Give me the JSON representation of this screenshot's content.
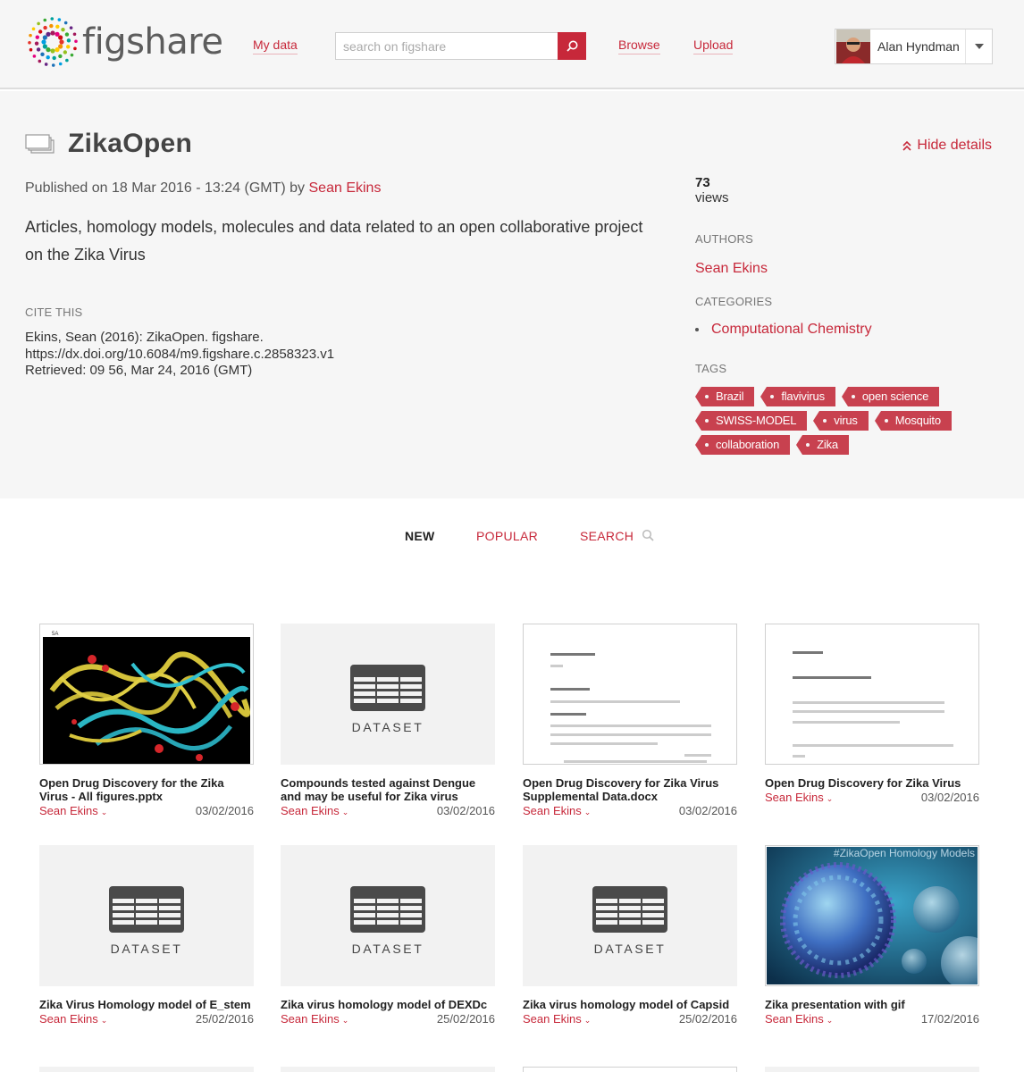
{
  "header": {
    "logo_text": "figshare",
    "nav": {
      "my_data": "My data",
      "browse": "Browse",
      "upload": "Upload"
    },
    "search_placeholder": "search on figshare",
    "user_name": "Alan Hyndman"
  },
  "collection": {
    "title": "ZikaOpen",
    "hide_details": "Hide details",
    "published_prefix": "Published on 18 Mar 2016 - 13:24 (GMT) by",
    "published_author": "Sean Ekins",
    "description": "Articles, homology models, molecules and data related to an open collaborative project on the Zika Virus",
    "cite_label": "CITE THIS",
    "cite_lines": [
      "Ekins, Sean (2016): ZikaOpen. figshare.",
      "https://dx.doi.org/10.6084/m9.figshare.c.2858323.v1",
      "Retrieved: 09 56, Mar 24, 2016 (GMT)"
    ],
    "views_count": "73",
    "views_label": "views",
    "authors_label": "AUTHORS",
    "author": "Sean Ekins",
    "categories_label": "CATEGORIES",
    "category": "Computational Chemistry",
    "tags_label": "TAGS",
    "tags": [
      "Brazil",
      "flavivirus",
      "open science",
      "SWISS-MODEL",
      "virus",
      "Mosquito",
      "collaboration",
      "Zika"
    ]
  },
  "tabs": {
    "new": "NEW",
    "popular": "POPULAR",
    "search": "SEARCH"
  },
  "colors": {
    "accent": "#c7283a",
    "tag_bg": "#c8414f",
    "panel_bg": "#f6f6f6"
  },
  "items": [
    {
      "title": "Open Drug Discovery for the Zika Virus - All figures.pptx",
      "author": "Sean Ekins",
      "date": "03/02/2016",
      "thumb": "protein-image",
      "thumb_caption": "5A"
    },
    {
      "title": "Compounds tested against Dengue and may be useful for Zika virus",
      "author": "Sean Ekins",
      "date": "03/02/2016",
      "thumb": "dataset",
      "thumb_label": "DATASET"
    },
    {
      "title": "Open Drug Discovery for Zika Virus Supplemental Data.docx",
      "author": "Sean Ekins",
      "date": "03/02/2016",
      "thumb": "document"
    },
    {
      "title": "Open Drug Discovery for Zika Virus",
      "author": "Sean Ekins",
      "date": "03/02/2016",
      "thumb": "document"
    },
    {
      "title": "Zika Virus Homology model of E_stem",
      "author": "Sean Ekins",
      "date": "25/02/2016",
      "thumb": "dataset",
      "thumb_label": "DATASET"
    },
    {
      "title": "Zika virus homology model of DEXDc",
      "author": "Sean Ekins",
      "date": "25/02/2016",
      "thumb": "dataset",
      "thumb_label": "DATASET"
    },
    {
      "title": "Zika virus homology model of Capsid",
      "author": "Sean Ekins",
      "date": "25/02/2016",
      "thumb": "dataset",
      "thumb_label": "DATASET"
    },
    {
      "title": "Zika presentation with gif",
      "author": "Sean Ekins",
      "date": "17/02/2016",
      "thumb": "virus-image",
      "thumb_caption": "#ZikaOpen Homology Models"
    }
  ]
}
